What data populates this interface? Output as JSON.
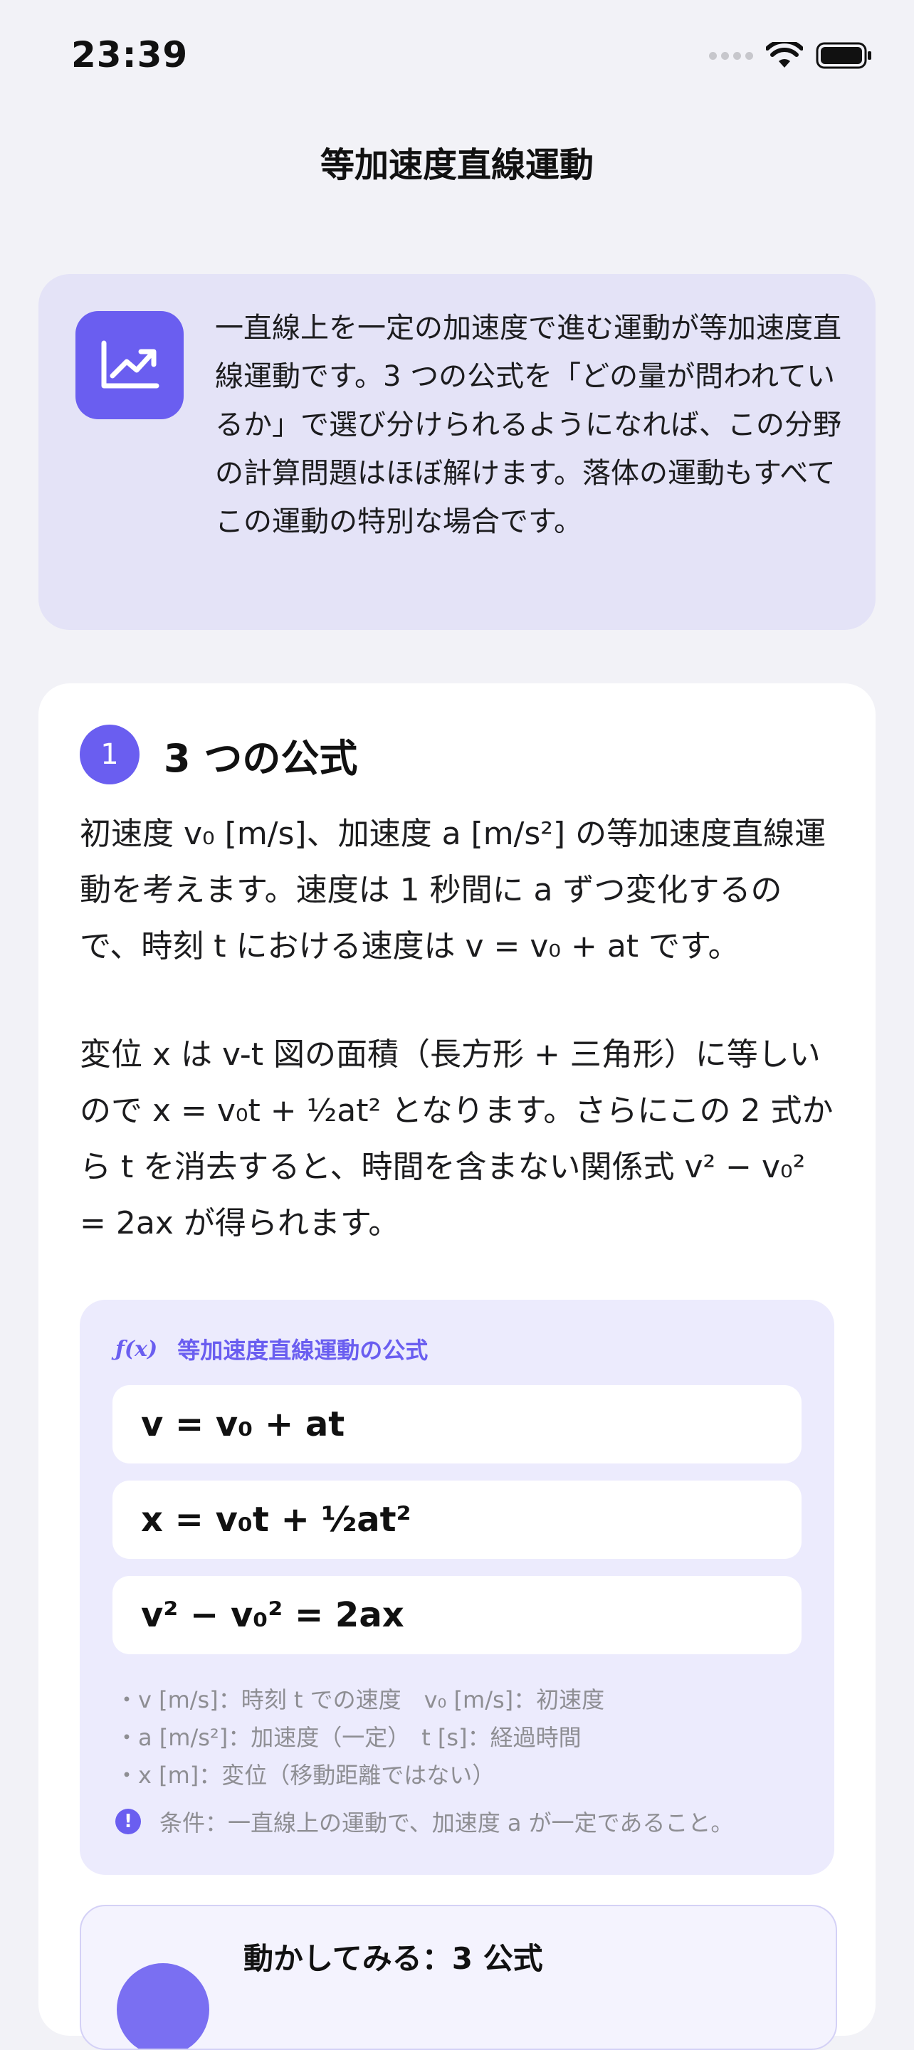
{
  "status": {
    "time": "23:39"
  },
  "nav": {
    "title": "等加速度直線運動"
  },
  "intro": {
    "icon": "chart-line-icon",
    "text": "一直線上を一定の加速度で進む運動が等加速度直線運動です。3 つの公式を「どの量が問われているか」で選び分けられるようになれば、この分野の計算問題はほぼ解けます。落体の運動もすべてこの運動の特別な場合です。"
  },
  "section": {
    "number": "1",
    "title": "3 つの公式",
    "paragraph1": "初速度 v₀ [m/s]、加速度 a [m/s²] の等加速度直線運動を考えます。速度は 1 秒間に a ずつ変化するので、時刻 t における速度は v = v₀ + at です。",
    "paragraph2": "変位 x は v-t 図の面積（長方形 + 三角形）に等しいので x = v₀t + ½at² となります。さらにこの 2 式から t を消去すると、時間を含まない関係式 v² − v₀² = 2ax が得られます。"
  },
  "formula_box": {
    "icon_label": "ƒ(x)",
    "title": "等加速度直線運動の公式",
    "formulas": [
      "v = v₀ + at",
      "x = v₀t + ½at²",
      "v² − v₀² = 2ax"
    ],
    "notes": [
      "・v [m/s]：時刻 t での速度　v₀ [m/s]：初速度",
      "・a [m/s²]：加速度（一定）　t [s]：経過時間",
      "・x [m]：変位（移動距離ではない）"
    ],
    "condition": "条件：一直線上の運動で、加速度 a が一定であること。",
    "condition_icon": "!"
  },
  "demo": {
    "title": "動かしてみる：3 公式"
  },
  "colors": {
    "accent": "#6A5EF0",
    "intro_bg": "#E4E3F7",
    "formula_bg": "#ECEBFD",
    "page_bg": "#F2F2F7"
  }
}
